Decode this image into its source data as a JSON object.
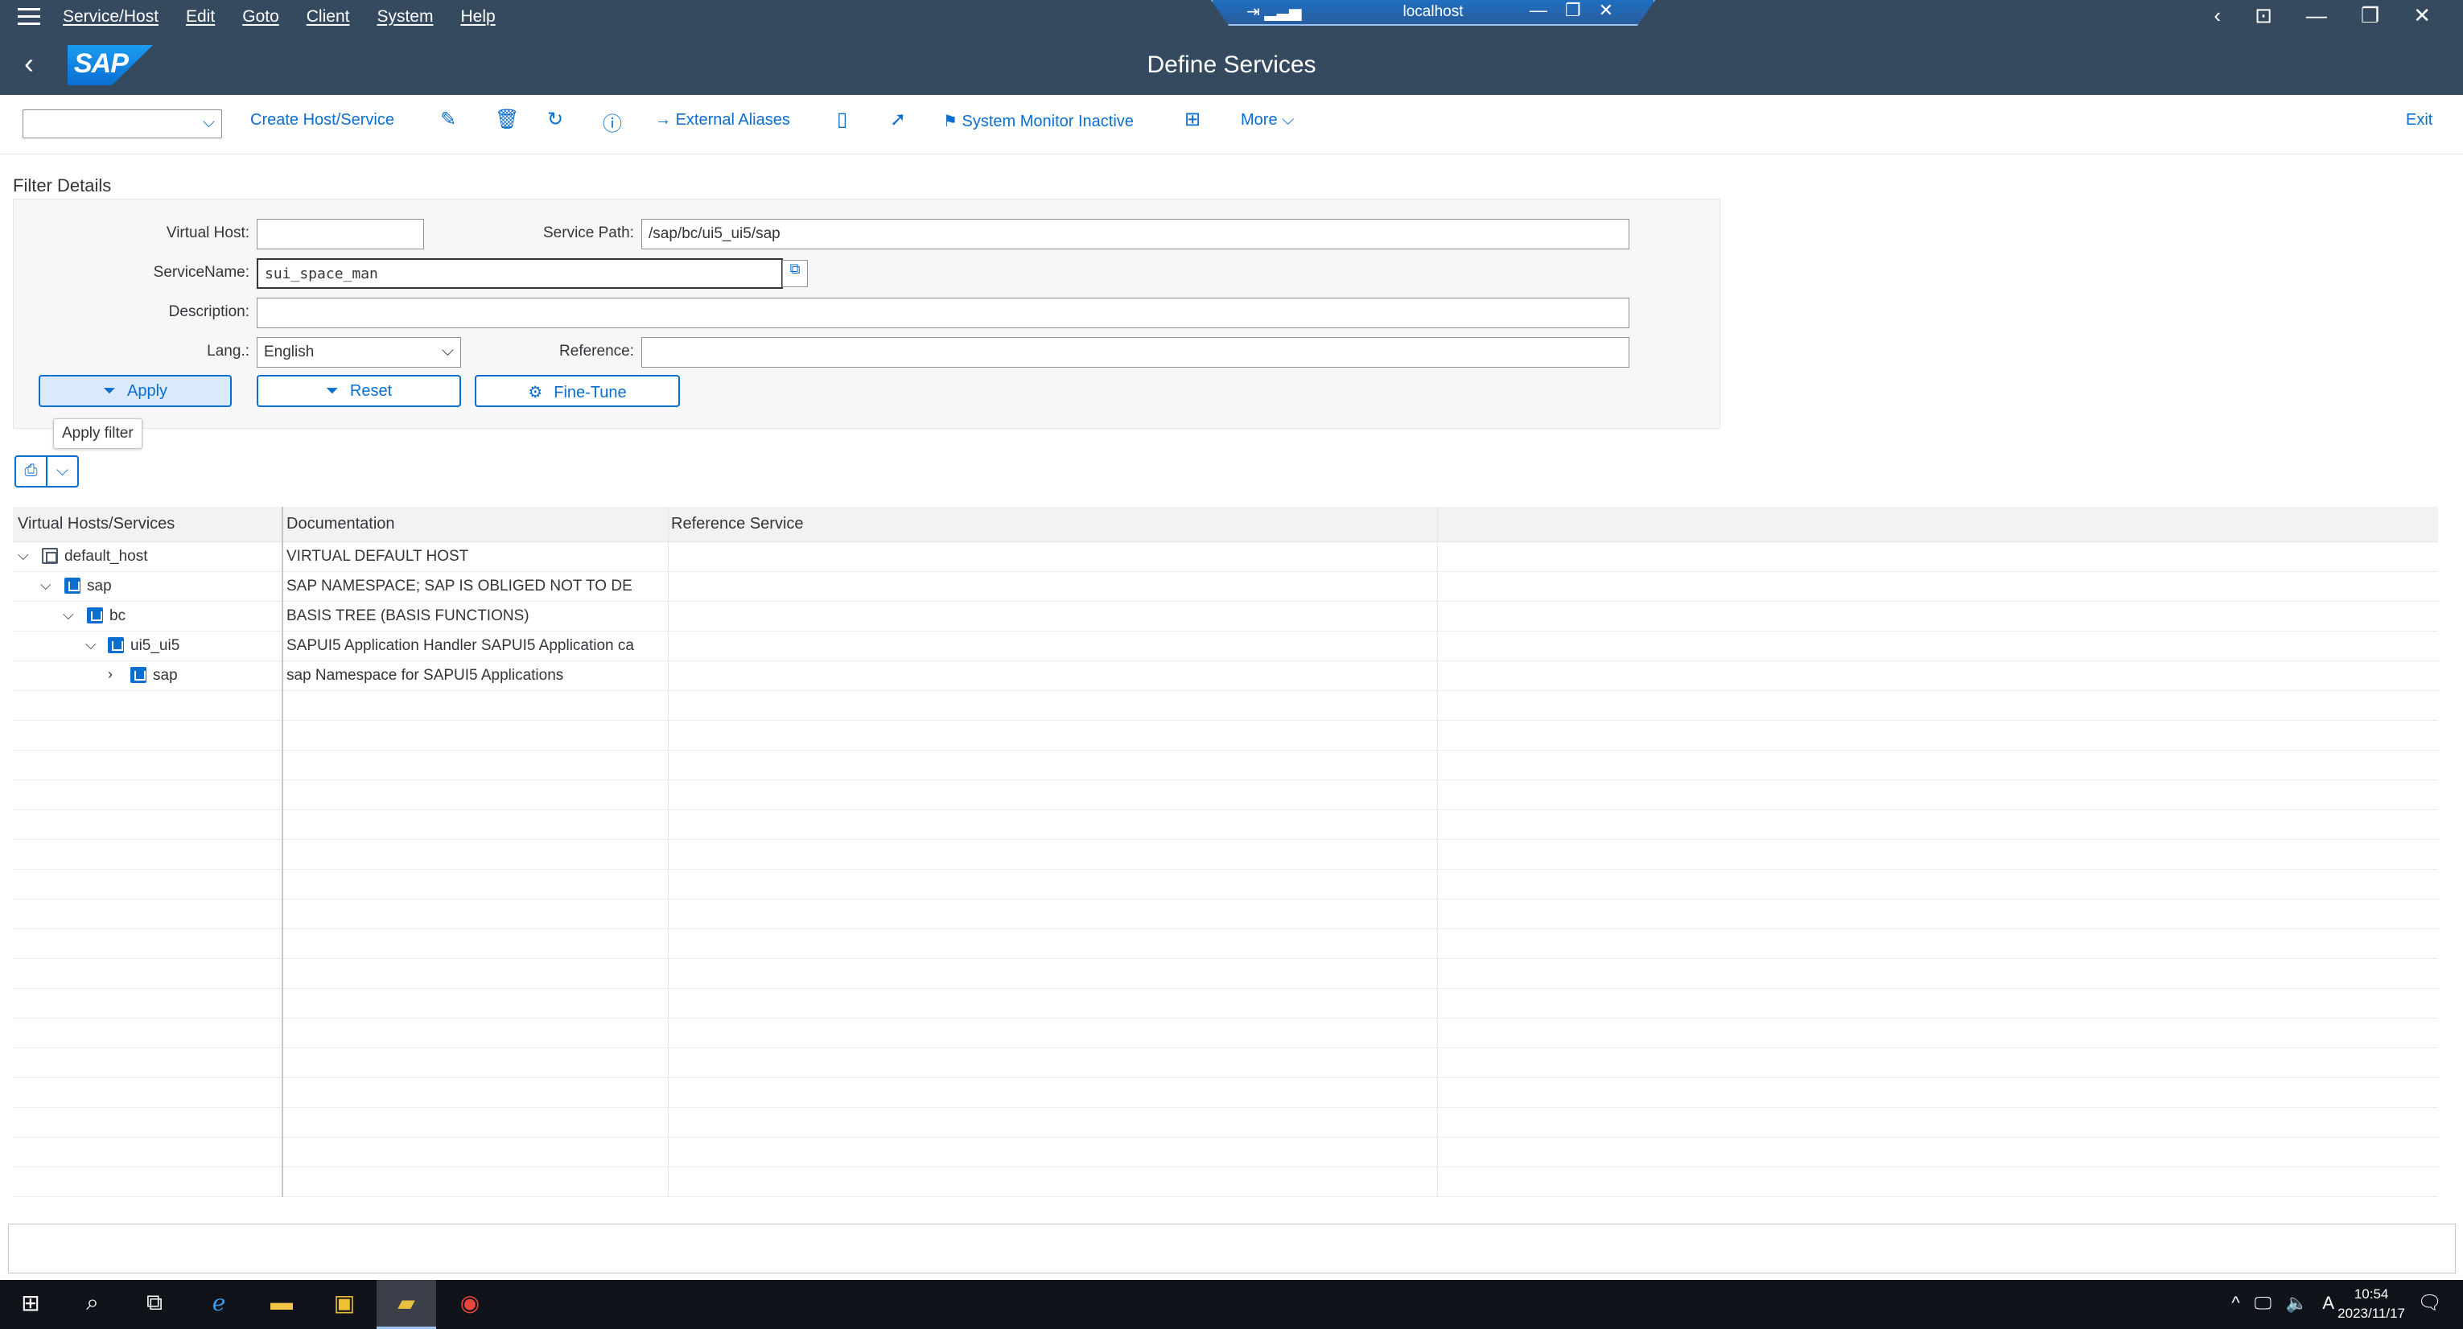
{
  "menubar": {
    "items": [
      "Service/Host",
      "Edit",
      "Goto",
      "Client",
      "System",
      "Help"
    ],
    "connection_host": "localhost"
  },
  "shell": {
    "title": "Define Services",
    "logo_text": "SAP"
  },
  "toolbar": {
    "variant_value": "",
    "create_label": "Create Host/Service",
    "external_aliases_label": "External Aliases",
    "system_monitor_label": "System Monitor Inactive",
    "more_label": "More",
    "exit_label": "Exit"
  },
  "filter": {
    "section_title": "Filter Details",
    "virtual_host_label": "Virtual Host:",
    "virtual_host_value": "",
    "service_path_label": "Service Path:",
    "service_path_value": "/sap/bc/ui5_ui5/sap",
    "service_name_label": "ServiceName:",
    "service_name_value": "sui_space_man",
    "description_label": "Description:",
    "description_value": "",
    "lang_label": "Lang.:",
    "lang_value": "English",
    "reference_label": "Reference:",
    "reference_value": "",
    "apply_label": "Apply",
    "reset_label": "Reset",
    "finetune_label": "Fine-Tune",
    "tooltip": "Apply filter"
  },
  "tree": {
    "columns": [
      "Virtual Hosts/Services",
      "Documentation",
      "Reference Service"
    ],
    "rows": [
      {
        "name": "default_host",
        "doc": "VIRTUAL DEFAULT HOST",
        "toggle": "expanded"
      },
      {
        "name": "sap",
        "doc": "SAP NAMESPACE; SAP IS OBLIGED NOT TO DE",
        "toggle": "expanded"
      },
      {
        "name": "bc",
        "doc": "BASIS TREE (BASIS FUNCTIONS)",
        "toggle": "expanded"
      },
      {
        "name": "ui5_ui5",
        "doc": "SAPUI5 Application Handler SAPUI5 Application ca",
        "toggle": "expanded"
      },
      {
        "name": "sap",
        "doc": "sap Namespace for SAPUI5 Applications",
        "toggle": "collapsed"
      }
    ]
  },
  "taskbar": {
    "time": "10:54",
    "date": "2023/11/17",
    "ime": "A"
  }
}
